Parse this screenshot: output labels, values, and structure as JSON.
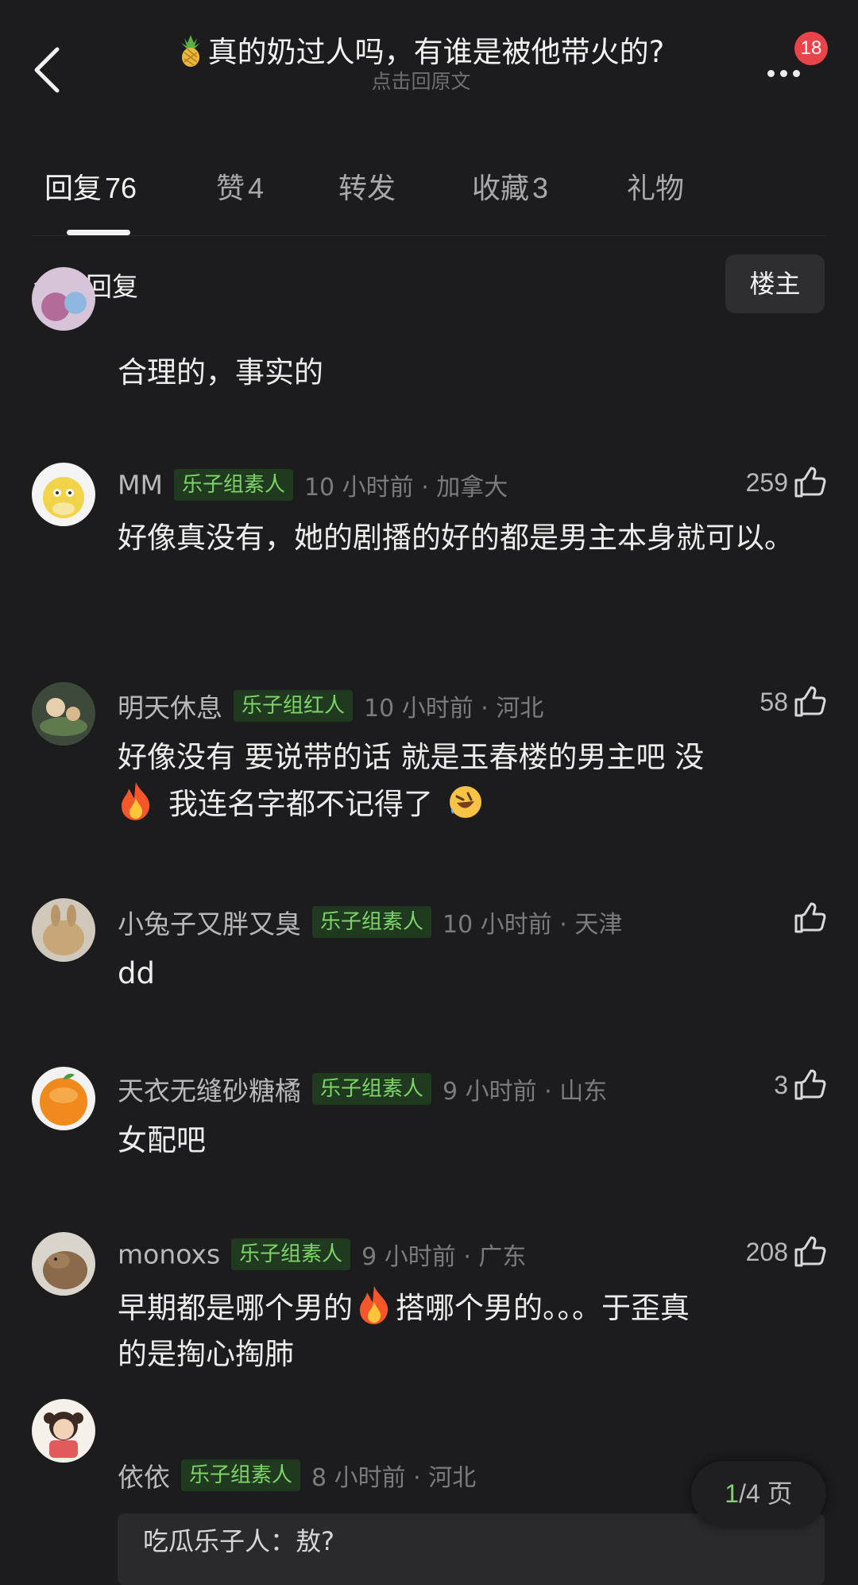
{
  "header": {
    "title": "真的奶过人吗，有谁是被他带火的?",
    "subtitle": "点击回原文",
    "notification_count": "18"
  },
  "tabs": [
    {
      "label": "回复",
      "count": "76"
    },
    {
      "label": "赞",
      "count": "4"
    },
    {
      "label": "转发",
      "count": ""
    },
    {
      "label": "收藏",
      "count": "3"
    },
    {
      "label": "礼物",
      "count": ""
    }
  ],
  "filter": {
    "all_replies": "全部回复",
    "op_only": "楼主"
  },
  "comments": [
    {
      "text": "合理的，事实的"
    },
    {
      "name": "MM",
      "tag": "乐子组素人",
      "meta": "10 小时前 · 加拿大",
      "likes": "259",
      "text": "好像真没有，她的剧播的好的都是男主本身就可以。"
    },
    {
      "name": "明天休息",
      "tag": "乐子组红人",
      "meta": "10 小时前 · 河北",
      "likes": "58",
      "text_a": "好像没有 要说带的话 就是玉春楼的男主吧 没",
      "text_b": "我连名字都不记得了"
    },
    {
      "name": "小兔子又胖又臭",
      "tag": "乐子组素人",
      "meta": "10 小时前 · 天津",
      "likes": "",
      "text": "dd"
    },
    {
      "name": "天衣无缝砂糖橘",
      "tag": "乐子组素人",
      "meta": "9 小时前 · 山东",
      "likes": "3",
      "text": "女配吧"
    },
    {
      "name": "monoxs",
      "tag": "乐子组素人",
      "meta": "9 小时前 · 广东",
      "likes": "208",
      "text_a": "早期都是哪个男的",
      "text_b": "搭哪个男的。。。于歪真",
      "text_c": "的是掏心掏肺"
    },
    {
      "name": "依依",
      "tag": "乐子组素人",
      "meta": "8 小时前 · 河北",
      "quote": "吃瓜乐子人：敖?"
    }
  ],
  "pager": {
    "current": "1",
    "total": "/4 页"
  },
  "colors": {
    "background": "#1c1c1e",
    "tag_green": "#7fd36b",
    "badge_red": "#e8444a"
  }
}
